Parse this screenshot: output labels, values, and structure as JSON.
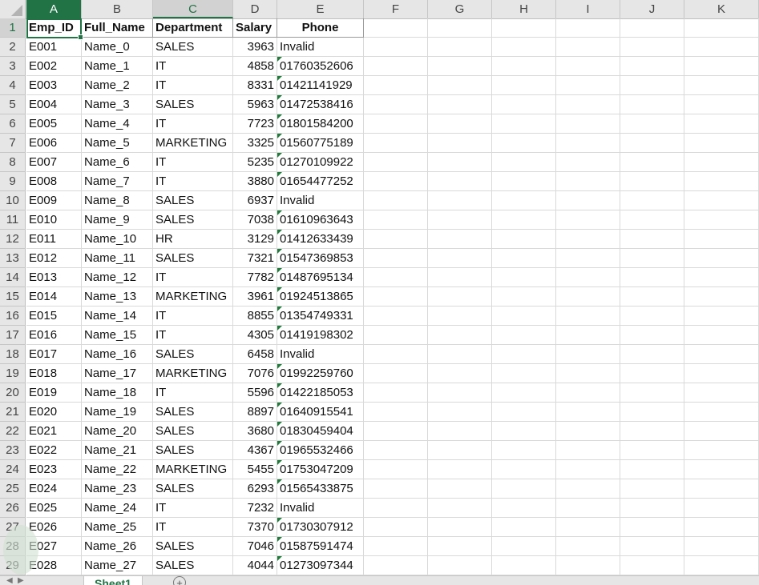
{
  "columns": [
    "A",
    "B",
    "C",
    "D",
    "E",
    "F",
    "G",
    "H",
    "I",
    "J",
    "K"
  ],
  "headers": [
    "Emp_ID",
    "Full_Name",
    "Department",
    "Salary",
    "Phone"
  ],
  "rows": [
    [
      "E001",
      "Name_0",
      "SALES",
      "3963",
      "Invalid"
    ],
    [
      "E002",
      "Name_1",
      "IT",
      "4858",
      "01760352606"
    ],
    [
      "E003",
      "Name_2",
      "IT",
      "8331",
      "01421141929"
    ],
    [
      "E004",
      "Name_3",
      "SALES",
      "5963",
      "01472538416"
    ],
    [
      "E005",
      "Name_4",
      "IT",
      "7723",
      "01801584200"
    ],
    [
      "E006",
      "Name_5",
      "MARKETING",
      "3325",
      "01560775189"
    ],
    [
      "E007",
      "Name_6",
      "IT",
      "5235",
      "01270109922"
    ],
    [
      "E008",
      "Name_7",
      "IT",
      "3880",
      "01654477252"
    ],
    [
      "E009",
      "Name_8",
      "SALES",
      "6937",
      "Invalid"
    ],
    [
      "E010",
      "Name_9",
      "SALES",
      "7038",
      "01610963643"
    ],
    [
      "E011",
      "Name_10",
      "HR",
      "3129",
      "01412633439"
    ],
    [
      "E012",
      "Name_11",
      "SALES",
      "7321",
      "01547369853"
    ],
    [
      "E013",
      "Name_12",
      "IT",
      "7782",
      "01487695134"
    ],
    [
      "E014",
      "Name_13",
      "MARKETING",
      "3961",
      "01924513865"
    ],
    [
      "E015",
      "Name_14",
      "IT",
      "8855",
      "01354749331"
    ],
    [
      "E016",
      "Name_15",
      "IT",
      "4305",
      "01419198302"
    ],
    [
      "E017",
      "Name_16",
      "SALES",
      "6458",
      "Invalid"
    ],
    [
      "E018",
      "Name_17",
      "MARKETING",
      "7076",
      "01992259760"
    ],
    [
      "E019",
      "Name_18",
      "IT",
      "5596",
      "01422185053"
    ],
    [
      "E020",
      "Name_19",
      "SALES",
      "8897",
      "01640915541"
    ],
    [
      "E021",
      "Name_20",
      "SALES",
      "3680",
      "01830459404"
    ],
    [
      "E022",
      "Name_21",
      "SALES",
      "4367",
      "01965532466"
    ],
    [
      "E023",
      "Name_22",
      "MARKETING",
      "5455",
      "01753047209"
    ],
    [
      "E024",
      "Name_23",
      "SALES",
      "6293",
      "01565433875"
    ],
    [
      "E025",
      "Name_24",
      "IT",
      "7232",
      "Invalid"
    ],
    [
      "E026",
      "Name_25",
      "IT",
      "7370",
      "01730307912"
    ],
    [
      "E027",
      "Name_26",
      "SALES",
      "7046",
      "01587591474"
    ],
    [
      "E028",
      "Name_27",
      "SALES",
      "4044",
      "01273097344"
    ]
  ],
  "sheet_tab": "Sheet1",
  "add_sheet_symbol": "+",
  "selected_column": "C",
  "active_cell": "A1",
  "colors": {
    "accent": "#217346",
    "header_bg": "#e6e6e6",
    "error_triangle": "#1e7b3a"
  }
}
